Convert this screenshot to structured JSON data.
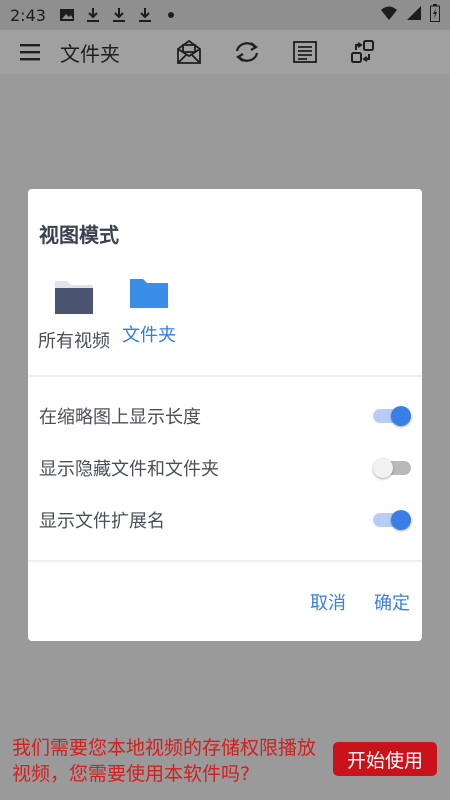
{
  "status_bar": {
    "time": "2:43",
    "icons": [
      "image-icon",
      "download-icon",
      "download-icon",
      "download-icon",
      "dot-icon",
      "wifi-icon",
      "signal-icon",
      "battery-icon"
    ]
  },
  "app_bar": {
    "title": "文件夹",
    "icons": [
      "menu-icon",
      "mail-icon",
      "refresh-icon",
      "list-icon",
      "share-icon"
    ]
  },
  "dialog": {
    "title": "视图模式",
    "modes": [
      {
        "label": "所有视频",
        "icon": "folder-icon",
        "color": "#4a5470",
        "selected": false
      },
      {
        "label": "文件夹",
        "icon": "folder-icon",
        "color": "#3a8ee8",
        "selected": true
      }
    ],
    "options": [
      {
        "label": "在缩略图上显示长度",
        "enabled": true
      },
      {
        "label": "显示隐藏文件和文件夹",
        "enabled": false
      },
      {
        "label": "显示文件扩展名",
        "enabled": true
      }
    ],
    "cancel_label": "取消",
    "ok_label": "确定"
  },
  "banner": {
    "text": "我们需要您本地视频的存储权限播放视频，您需要使用本软件吗?",
    "button_label": "开始使用"
  },
  "colors": {
    "accent": "#3a7fe8",
    "warning_text": "#d21f1f",
    "warning_button": "#c9121a",
    "scrim": "#9a9a9a"
  }
}
